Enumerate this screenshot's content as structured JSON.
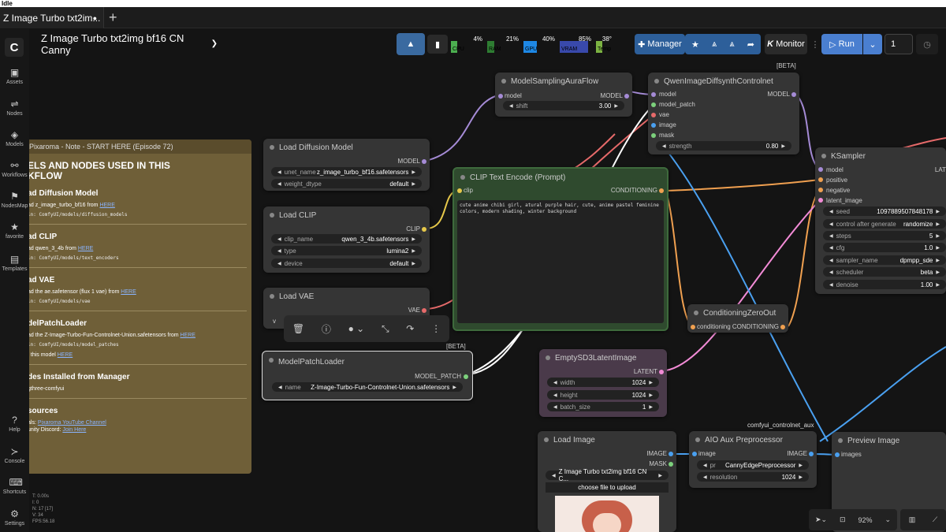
{
  "status": "Idle",
  "tab": {
    "title": "Z Image Turbo txt2im...",
    "dot": "●"
  },
  "new_tab": "+",
  "workflow_title": "Z Image Turbo txt2img bf16 CN Canny",
  "sidebar": [
    {
      "label": "Assets",
      "icon": "image-icon"
    },
    {
      "label": "Nodes",
      "icon": "nodes-icon"
    },
    {
      "label": "Models",
      "icon": "cube-icon"
    },
    {
      "label": "Workflows",
      "icon": "workflow-icon"
    },
    {
      "label": "NodesMap",
      "icon": "map-icon"
    },
    {
      "label": "favorite",
      "icon": "star-icon"
    },
    {
      "label": "Templates",
      "icon": "template-icon"
    }
  ],
  "sidebar_bottom": [
    {
      "label": "Help",
      "icon": "help-icon"
    },
    {
      "label": "Console",
      "icon": "console-icon"
    },
    {
      "label": "Shortcuts",
      "icon": "keyboard-icon"
    },
    {
      "label": "Settings",
      "icon": "gear-icon"
    }
  ],
  "meters": [
    {
      "label": "CPU",
      "pct": "4%",
      "level": 0.04,
      "color": "#4caf50"
    },
    {
      "label": "RAM",
      "pct": "21%",
      "level": 0.21,
      "color": "#2e7d32"
    },
    {
      "label": "GPU",
      "pct": "40%",
      "level": 0.4,
      "color": "#1e88e5"
    },
    {
      "label": "VRAM",
      "pct": "85%",
      "level": 0.85,
      "color": "#3949ab"
    },
    {
      "label": "Temp",
      "pct": "38°",
      "level": 0.38,
      "color": "#7cb342"
    }
  ],
  "toolbar": {
    "manager": "Manager",
    "monitor": "Monitor",
    "run": "Run",
    "queue_count": "1"
  },
  "beta": "[BETA]",
  "nodes": {
    "model_sampling": {
      "title": "ModelSamplingAuraFlow",
      "in": "model",
      "out": "MODEL",
      "shift_label": "shift",
      "shift": "3.00"
    },
    "qwen_cn": {
      "title": "QwenImageDiffsynthControlnet",
      "ins": [
        "model",
        "model_patch",
        "vae",
        "image",
        "mask"
      ],
      "out": "MODEL",
      "strength_label": "strength",
      "strength": "0.80"
    },
    "load_diffusion": {
      "title": "Load Diffusion Model",
      "out": "MODEL",
      "unet_label": "unet_name",
      "unet": "z_image_turbo_bf16.safetensors",
      "dtype_label": "weight_dtype",
      "dtype": "default"
    },
    "load_clip": {
      "title": "Load CLIP",
      "out": "CLIP",
      "clip_label": "clip_name",
      "clip": "qwen_3_4b.safetensors",
      "type_label": "type",
      "type": "lumina2",
      "device_label": "device",
      "device": "default"
    },
    "load_vae": {
      "title": "Load VAE",
      "out": "VAE",
      "v": "v"
    },
    "clip_text": {
      "title": "CLIP Text Encode (Prompt)",
      "in": "clip",
      "out": "CONDITIONING",
      "prompt": "cute anime chibi girl, atural purple hair, cute, anime pastel feminine colors, modern shading, winter background"
    },
    "ksampler": {
      "title": "KSampler",
      "ins": [
        "model",
        "positive",
        "negative",
        "latent_image"
      ],
      "out": "LAT",
      "widgets": [
        [
          "seed",
          "1097889507848178"
        ],
        [
          "control after generate",
          "randomize"
        ],
        [
          "steps",
          "5"
        ],
        [
          "cfg",
          "1.0"
        ],
        [
          "sampler_name",
          "dpmpp_sde"
        ],
        [
          "scheduler",
          "beta"
        ],
        [
          "denoise",
          "1.00"
        ]
      ]
    },
    "model_patch": {
      "title": "ModelPatchLoader",
      "out": "MODEL_PATCH",
      "name_label": "name",
      "name": "Z-Image-Turbo-Fun-Controlnet-Union.safetensors"
    },
    "cond_zero": {
      "title": "ConditioningZeroOut",
      "in": "conditioning",
      "out": "CONDITIONING"
    },
    "empty_latent": {
      "title": "EmptySD3LatentImage",
      "out": "LATENT",
      "widgets": [
        [
          "width",
          "1024"
        ],
        [
          "height",
          "1024"
        ],
        [
          "batch_size",
          "1"
        ]
      ]
    },
    "load_image": {
      "title": "Load Image",
      "outs": [
        "IMAGE",
        "MASK"
      ],
      "file": "Z Image Turbo txt2img bf16 CN C...",
      "upload": "choose file to upload"
    },
    "aio": {
      "title": "AIO Aux Preprocessor",
      "in": "image",
      "out": "IMAGE",
      "pr_label": "pr",
      "pr": "CannyEdgePreprocessor",
      "res_label": "resolution",
      "res": "1024"
    },
    "preview": {
      "title": "Preview Image",
      "in": "images"
    }
  },
  "group_label": "comfyui_controlnet_aux",
  "note": {
    "title": "Pixaroma - Note - START HERE (Episode 72)",
    "heading": "ELS AND NODES USED IN THIS\nKFLOW",
    "sections": [
      {
        "h": "ad Diffusion Model",
        "p": "ad z_image_turbo_bf16 from",
        "link": "HERE",
        "path": "in: ComfyUI/models/diffusion_models"
      },
      {
        "h": "ad CLIP",
        "p": "ad qwen_3_4b from",
        "link": "HERE",
        "path": "in: ComfyUI/models/text_encoders"
      },
      {
        "h": "ad VAE",
        "p": "ad the ae.safetensor (flux 1 vae) from",
        "link": "HERE",
        "path": "in: ComfyUI/models/vae"
      },
      {
        "h": "delPatchLoader",
        "p": "ad the Z-Image-Turbo-Fun-Controlnet-Union.safetensors from",
        "link": "HERE",
        "path": "in: ComfyUI/models/model_patches",
        "extra": "t this model",
        "extra_link": "HERE"
      },
      {
        "h": "des Installed from Manager",
        "p": "gthree-comfyui"
      },
      {
        "h": "sources",
        "p": "als:",
        "link": "Pixaroma YouTube Channel",
        "p2": "unity Discord:",
        "link2": "Join Here"
      }
    ]
  },
  "stats": [
    "T: 0.00s",
    "I: 0",
    "N: 17 [17]",
    "V: 34",
    "FPS:56.18"
  ],
  "zoom": "92%"
}
